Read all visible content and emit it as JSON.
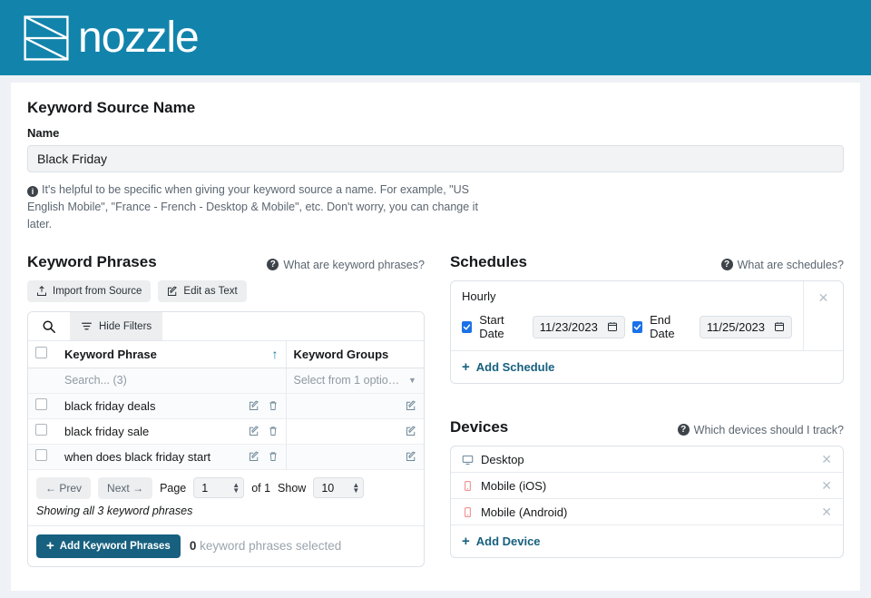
{
  "header": {
    "logo_icon": "nozzle-bowtie-logo",
    "brand": "nozzle",
    "brand_color": "#1284ac"
  },
  "source_name": {
    "section_title": "Keyword Source Name",
    "field_label": "Name",
    "value": "Black Friday",
    "placeholder": "Name",
    "help_icon": "info-circle-icon",
    "help_text": "It's helpful to be specific when giving your keyword source a name. For example, \"US English Mobile\", \"France - French - Desktop & Mobile\", etc. Don't worry, you can change it later."
  },
  "keyword_phrases": {
    "title": "Keyword Phrases",
    "help_link": "What are keyword phrases?",
    "help_icon": "question-circle-icon",
    "buttons": {
      "import": "Import from Source",
      "import_icon": "upload-icon",
      "edit_as_text": "Edit as Text",
      "edit_icon": "pencil-square-icon"
    },
    "filter_bar": {
      "search_icon": "search-icon",
      "hide_filters": "Hide Filters",
      "filter_icon": "filter-icon"
    },
    "columns": {
      "keyword_phrase": "Keyword Phrase",
      "keyword_groups": "Keyword Groups",
      "sort_indicator": "▲"
    },
    "filters": {
      "phrase_search": "Search... (3)",
      "group_select": "Select from 1 optio…",
      "caret_icon": "chevron-down-icon"
    },
    "rows": [
      {
        "phrase": "black friday deals",
        "groups": ""
      },
      {
        "phrase": "black friday sale",
        "groups": ""
      },
      {
        "phrase": "when does black friday start",
        "groups": ""
      }
    ],
    "row_icons": {
      "edit": "pencil-square-icon",
      "delete": "trash-icon",
      "group_edit": "pencil-square-icon"
    },
    "pagination": {
      "prev": "Prev",
      "prev_icon": "arrow-left-icon",
      "next": "Next",
      "next_icon": "arrow-right-icon",
      "page_label": "Page",
      "page_value": "1",
      "of_label": "of 1",
      "show_label": "Show",
      "show_value": "10",
      "showing_text": "Showing all 3 keyword phrases"
    },
    "footer": {
      "add_button": "Add Keyword Phrases",
      "add_icon": "plus-icon",
      "selected_count": "0",
      "selected_text": "keyword phrases selected"
    }
  },
  "schedules": {
    "title": "Schedules",
    "help_link": "What are schedules?",
    "help_icon": "question-circle-icon",
    "items": [
      {
        "name": "Hourly",
        "start_label": "Start Date",
        "start_checked": true,
        "start_date": "11/23/2023",
        "end_label": "End Date",
        "end_checked": true,
        "end_date": "11/25/2023",
        "remove_icon": "close-icon",
        "calendar_icon": "calendar-icon"
      }
    ],
    "add_label": "Add Schedule",
    "add_icon": "plus-icon"
  },
  "devices": {
    "title": "Devices",
    "help_link": "Which devices should I track?",
    "help_icon": "question-circle-icon",
    "items": [
      {
        "label": "Desktop",
        "icon": "desktop-monitor-icon",
        "remove_icon": "close-icon"
      },
      {
        "label": "Mobile (iOS)",
        "icon": "mobile-phone-icon",
        "remove_icon": "close-icon"
      },
      {
        "label": "Mobile (Android)",
        "icon": "mobile-phone-icon",
        "remove_icon": "close-icon"
      }
    ],
    "add_label": "Add Device",
    "add_icon": "plus-icon"
  }
}
